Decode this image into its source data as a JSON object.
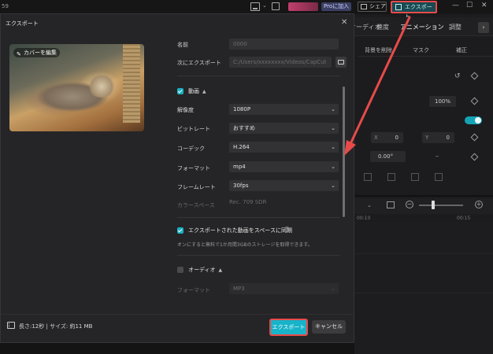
{
  "app": {
    "top_num": "59",
    "pro_label": "Proに加入",
    "share_label": "シェア",
    "export_label": "エクスポート",
    "win_min": "—",
    "win_max": "☐",
    "win_close": "✕"
  },
  "right_panel": {
    "tabs": [
      "オーディオ",
      "速度",
      "アニメーション",
      "調整"
    ],
    "subtabs": [
      "背景を削除",
      "マスク",
      "補正"
    ],
    "scale_value": "100%",
    "x_label": "X",
    "x_value": "0",
    "y_label": "Y",
    "y_value": "0",
    "rotation_value": "0.00°",
    "dash": "–",
    "timeline_times": [
      "00:10",
      "00:15"
    ]
  },
  "dialog": {
    "title": "エクスポート",
    "close": "✕",
    "cover_edit": "カバーを編集",
    "name_label": "名前",
    "name_value": "0000",
    "export_to_label": "次にエクスポート",
    "export_to_value": "C:/Users/xxxxxxxx/Videos/CapCut",
    "video_section": "動画",
    "settings": [
      {
        "label": "解像度",
        "value": "1080P"
      },
      {
        "label": "ビットレート",
        "value": "おすすめ"
      },
      {
        "label": "コーデック",
        "value": "H.264"
      },
      {
        "label": "フォーマット",
        "value": "mp4"
      },
      {
        "label": "フレームレート",
        "value": "30fps"
      }
    ],
    "color_space_label": "カラースペース",
    "color_space_value": "Rec. 709 SDR",
    "sync_label": "エクスポートされた動画をスペースに同期",
    "sync_note": "オンにすると無料で1か月間3GBのストレージを取得できます。",
    "audio_section": "オーディオ",
    "audio_format_label": "フォーマット",
    "audio_format_value": "MP3",
    "footer_info": "長さ:12秒 | サイズ: 約11 MB",
    "export_button": "エクスポート",
    "cancel_button": "キャンセル"
  },
  "colors": {
    "accent": "#17b3c9",
    "highlight": "#e84a4a",
    "dialog_bg": "#252527"
  }
}
